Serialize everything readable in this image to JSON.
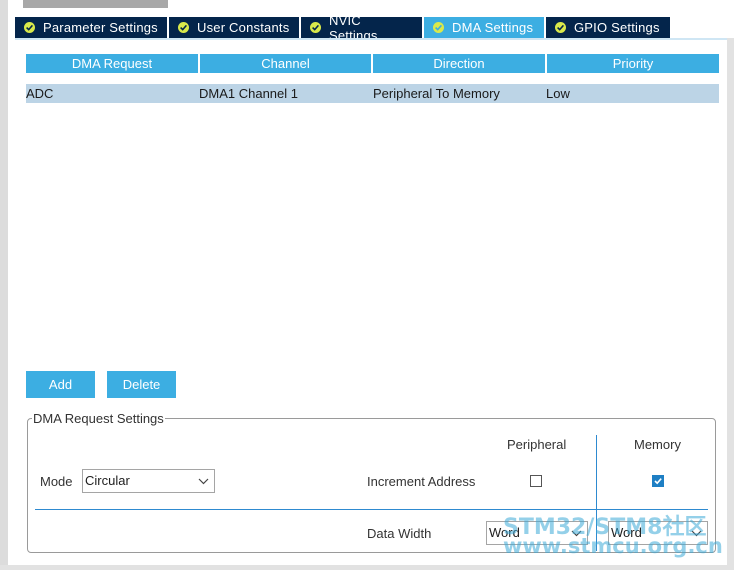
{
  "tabs": [
    {
      "label": "Parameter Settings",
      "active": false
    },
    {
      "label": "User Constants",
      "active": false
    },
    {
      "label": "NVIC Settings",
      "active": false
    },
    {
      "label": "DMA Settings",
      "active": true
    },
    {
      "label": "GPIO Settings",
      "active": false
    }
  ],
  "table": {
    "headers": [
      "DMA Request",
      "Channel",
      "Direction",
      "Priority"
    ],
    "rows": [
      [
        "ADC",
        "DMA1 Channel 1",
        "Peripheral To Memory",
        "Low"
      ]
    ]
  },
  "buttons": {
    "add": "Add",
    "delete": "Delete"
  },
  "settings": {
    "title": "DMA Request Settings",
    "mode_label": "Mode",
    "mode_value": "Circular",
    "col_peripheral": "Peripheral",
    "col_memory": "Memory",
    "increment_label": "Increment Address",
    "increment_peripheral": false,
    "increment_memory": true,
    "width_label": "Data Width",
    "width_peripheral": "Word",
    "width_memory": "Word"
  },
  "watermark": {
    "line1": "STM32/STM8社区",
    "line2": "www.stmcu.org.cn"
  },
  "colors": {
    "tab_bg": "#04254b",
    "accent": "#3caee2",
    "selected_row": "#bcd4e6",
    "check": "#d9e94b"
  }
}
